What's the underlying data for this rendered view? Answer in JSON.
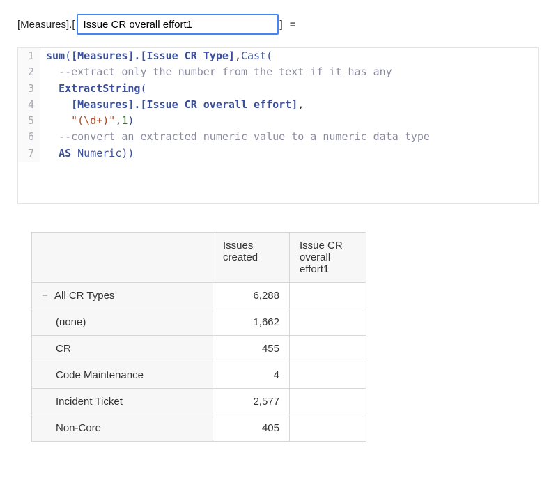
{
  "measure": {
    "prefix": "[Measures].[",
    "input_value": "Issue CR overall effort1",
    "input_placeholder": "",
    "suffix": "]",
    "equals": "="
  },
  "code": {
    "lines": [
      {
        "n": "1",
        "html": "<span class='tok-fn'>sum</span><span class='tok-paren'>(</span><span class='tok-ident'>[Measures].[Issue CR Type]</span><span class='tok-plain'>,</span><span class='tok-cast'>Cast</span><span class='tok-paren'>(</span>"
      },
      {
        "n": "2",
        "html": "  <span class='tok-comment'>--extract only the number from the text if it has any</span>"
      },
      {
        "n": "3",
        "html": "  <span class='tok-fn'>ExtractString</span><span class='tok-paren'>(</span>"
      },
      {
        "n": "4",
        "html": "    <span class='tok-ident'>[Measures].[Issue CR overall effort]</span><span class='tok-plain'>,</span>"
      },
      {
        "n": "5",
        "html": "    <span class='tok-str'>\"(\\d+)\"</span><span class='tok-plain'>,</span><span class='tok-num'>1</span><span class='tok-paren'>)</span>"
      },
      {
        "n": "6",
        "html": "  <span class='tok-comment'>--convert an extracted numeric value to a numeric data type</span>"
      },
      {
        "n": "7",
        "html": "  <span class='tok-kw'>AS</span> <span class='tok-type'>Numeric</span><span class='tok-paren'>))</span>"
      }
    ]
  },
  "table": {
    "headers": {
      "rowlabel": "",
      "col1": "Issues created",
      "col2": "Issue CR overall effort1"
    },
    "rows": [
      {
        "label": "All CR Types",
        "expander": "−",
        "indent": 0,
        "col1": "6,288",
        "col2": ""
      },
      {
        "label": "(none)",
        "expander": "",
        "indent": 1,
        "col1": "1,662",
        "col2": ""
      },
      {
        "label": "CR",
        "expander": "",
        "indent": 1,
        "col1": "455",
        "col2": ""
      },
      {
        "label": "Code Maintenance",
        "expander": "",
        "indent": 1,
        "col1": "4",
        "col2": ""
      },
      {
        "label": "Incident Ticket",
        "expander": "",
        "indent": 1,
        "col1": "2,577",
        "col2": ""
      },
      {
        "label": "Non-Core",
        "expander": "",
        "indent": 1,
        "col1": "405",
        "col2": ""
      }
    ]
  }
}
